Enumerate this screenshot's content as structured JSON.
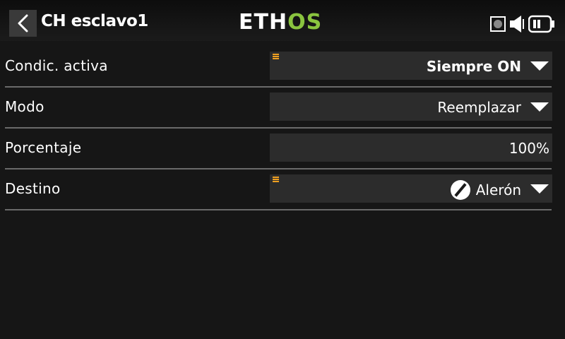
{
  "header": {
    "title": "CH esclavo1",
    "logo_left": "ETH",
    "logo_right": "OS",
    "icons": [
      "back-arrow-icon",
      "record-icon",
      "speaker-icon",
      "battery-icon"
    ]
  },
  "rows": [
    {
      "label": "Condic. activa",
      "value": "Siempre ON",
      "has_menu_marker": true,
      "dropdown": true
    },
    {
      "label": "Modo",
      "value": "Reemplazar",
      "has_menu_marker": false,
      "dropdown": true
    },
    {
      "label": "Porcentaje",
      "value": "100%",
      "has_menu_marker": false,
      "dropdown": false
    },
    {
      "label": "Destino",
      "value": "Alerón",
      "has_menu_marker": true,
      "dropdown": true,
      "icon": "slash-circle-icon"
    }
  ],
  "colors": {
    "accent": "#8ac43f",
    "menu_marker": "#f0a020",
    "field_bg": "#2c2c2c",
    "background": "#161616"
  }
}
